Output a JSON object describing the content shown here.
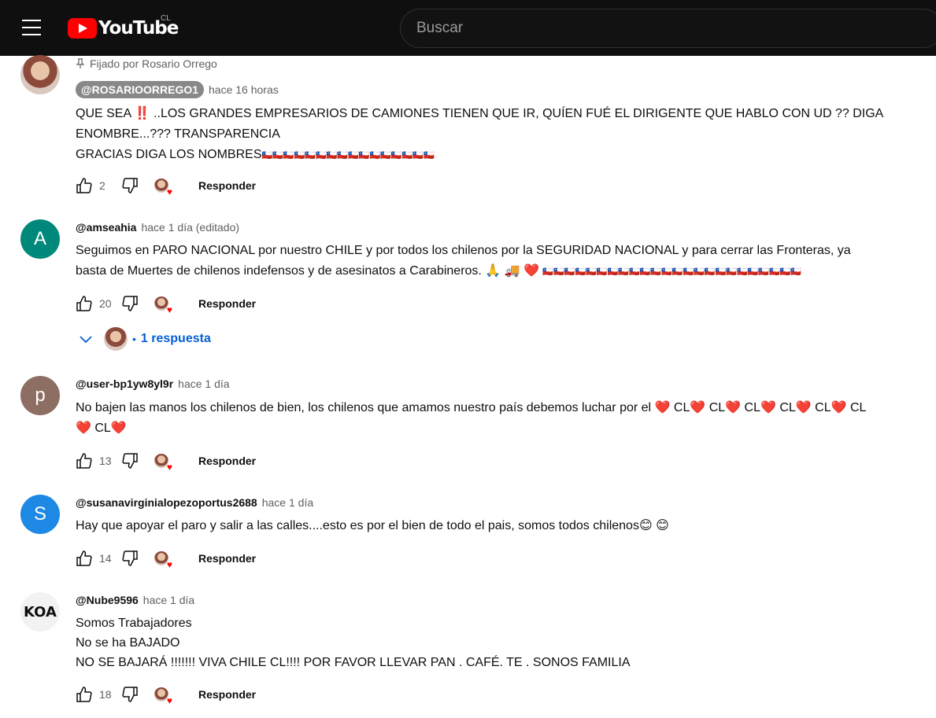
{
  "topbar": {
    "logo_text": "YouTube",
    "country": "CL",
    "search_placeholder": "Buscar"
  },
  "pinned": {
    "pin_label": "Fijado por Rosario Orrego"
  },
  "comments": [
    {
      "author": "@ROSARIOORREGO1",
      "time": "hace 16 horas",
      "lines": [
        "QUE SEA ‼️ ..LOS GRANDES EMPRESARIOS DE CAMIONES TIENEN QUE IR, QUÍEN FUÉ EL DIRIGENTE QUE HABLO CON UD  ?? DIGA",
        "ENOMBRE...??? TRANSPARENCIA",
        "GRACIAS   DIGA LOS NOMBRES"
      ],
      "flags": "🇨🇱🇨🇱🇨🇱🇨🇱🇨🇱🇨🇱🇨🇱🇨🇱🇨🇱🇨🇱🇨🇱🇨🇱🇨🇱🇨🇱🇨🇱🇨🇱",
      "likes": "2",
      "reply_label": "Responder"
    },
    {
      "author": "@amseahia",
      "time": "hace 1 día (editado)",
      "avatar_letter": "A",
      "avatar_color": "#00897b",
      "lines": [
        "Seguimos en PARO NACIONAL por nuestro CHILE y por todos los chilenos por la SEGURIDAD NACIONAL y para cerrar las Fronteras,  ya",
        "basta de Muertes de chilenos indefensos y de asesinatos a Carabineros. 🙏 🚚 ❤️"
      ],
      "flags": "🇨🇱🇨🇱🇨🇱🇨🇱🇨🇱🇨🇱🇨🇱🇨🇱🇨🇱🇨🇱🇨🇱🇨🇱🇨🇱🇨🇱🇨🇱🇨🇱🇨🇱🇨🇱🇨🇱🇨🇱🇨🇱🇨🇱🇨🇱🇨🇱",
      "likes": "20",
      "reply_label": "Responder",
      "replies_label": "1 respuesta"
    },
    {
      "author": "@user-bp1yw8yl9r",
      "time": "hace 1 día",
      "avatar_letter": "p",
      "avatar_color": "#8d6e63",
      "lines": [
        "No bajen las manos los chilenos de bien, los chilenos que amamos nuestro país debemos luchar por el ❤️ CL❤️ CL❤️ CL❤️ CL❤️ CL❤️ CL",
        "❤️ CL❤️"
      ],
      "likes": "13",
      "reply_label": "Responder"
    },
    {
      "author": "@susanavirginialopezoportus2688",
      "time": "hace 1 día",
      "avatar_letter": "S",
      "avatar_color": "#1e88e5",
      "lines": [
        "Hay que apoyar el paro y salir a las calles....esto es por el bien de todo el pais, somos todos chilenos😊 😊"
      ],
      "likes": "14",
      "reply_label": "Responder"
    },
    {
      "author": "@Nube9596",
      "time": "hace 1 día",
      "avatar_letter": "KOA",
      "lines": [
        "Somos Trabajadores",
        "No se ha BAJADO",
        "NO SE BAJARÁ !!!!!!! VIVA CHILE CL!!!! POR FAVOR LLEVAR PAN . CAFÉ. TE . SONOS FAMILIA"
      ],
      "likes": "18",
      "reply_label": "Responder"
    }
  ]
}
